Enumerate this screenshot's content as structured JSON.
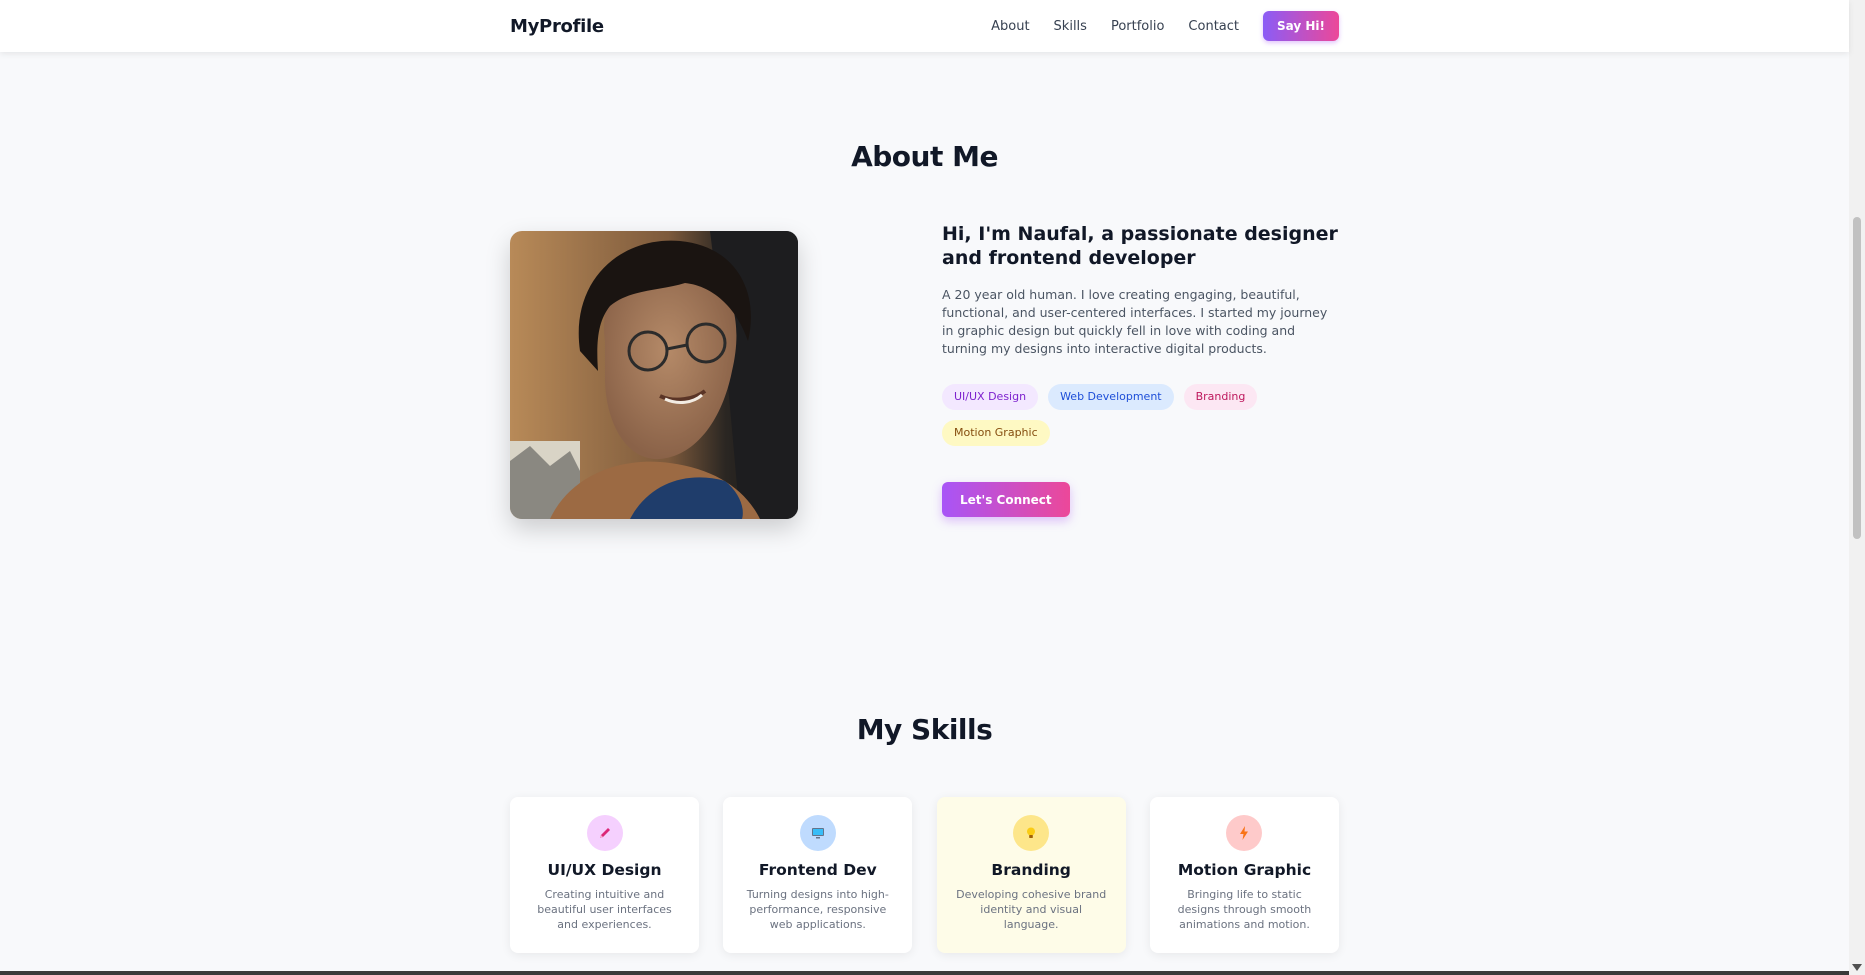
{
  "nav": {
    "brand": "MyProfile",
    "links": [
      "About",
      "Skills",
      "Portfolio",
      "Contact"
    ],
    "cta": "Say Hi!"
  },
  "about": {
    "title": "About Me",
    "heading": "Hi, I'm Naufal, a passionate designer and frontend developer",
    "bio": "A 20 year old human. I love creating engaging, beautiful, functional, and user-centered interfaces. I started my journey in graphic design but quickly fell in love with coding and turning my designs into interactive digital products.",
    "tags": [
      {
        "label": "UI/UX Design",
        "bg": "#f3e8ff",
        "color": "#7e22ce"
      },
      {
        "label": "Web Development",
        "bg": "#dbeafe",
        "color": "#1d4ed8"
      },
      {
        "label": "Branding",
        "bg": "#fce7f3",
        "color": "#be185d"
      },
      {
        "label": "Motion Graphic",
        "bg": "#fef9c3",
        "color": "#854d0e"
      }
    ],
    "cta": "Let's Connect"
  },
  "skills": {
    "title": "My Skills",
    "cards": [
      {
        "name": "UI/UX Design",
        "desc": "Creating intuitive and beautiful user interfaces and experiences.",
        "icon": "pencil-icon",
        "icon_bg": "#f5d0fe",
        "card_bg": "#ffffff"
      },
      {
        "name": "Frontend Dev",
        "desc": "Turning designs into high-performance, responsive web applications.",
        "icon": "computer-icon",
        "icon_bg": "#bfdbfe",
        "card_bg": "#ffffff"
      },
      {
        "name": "Branding",
        "desc": "Developing cohesive brand identity and visual language.",
        "icon": "lightbulb-icon",
        "icon_bg": "#fde68a",
        "card_bg": "#fefce8"
      },
      {
        "name": "Motion Graphic",
        "desc": "Bringing life to static designs through smooth animations and motion.",
        "icon": "lightning-icon",
        "icon_bg": "#fecaca",
        "card_bg": "#ffffff"
      }
    ]
  }
}
